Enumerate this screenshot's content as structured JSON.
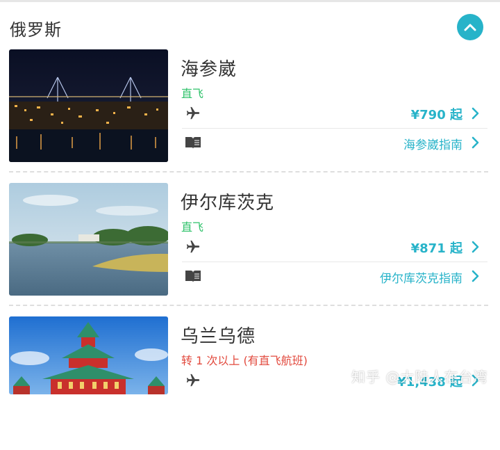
{
  "section": {
    "title": "俄罗斯",
    "collapse_icon": "chevron-up-icon",
    "accent_color": "#27b3c9"
  },
  "cards": [
    {
      "city": "海参崴",
      "route": "直飞",
      "route_type": "direct",
      "price": "¥790 起",
      "guide": "海参崴指南",
      "image": "night-bridge-city-photo"
    },
    {
      "city": "伊尔库茨克",
      "route": "直飞",
      "route_type": "direct",
      "price": "¥871 起",
      "guide": "伊尔库茨克指南",
      "image": "lake-landscape-photo"
    },
    {
      "city": "乌兰乌德",
      "route": "转 1 次以上 (有直飞航班)",
      "route_type": "transfer",
      "price": "¥1,438 起",
      "image": "temple-photo"
    }
  ],
  "colors": {
    "direct": "#2ec26a",
    "transfer": "#e2493d",
    "link": "#27b3c9"
  },
  "watermark": "知乎 @大陆人在台湾"
}
